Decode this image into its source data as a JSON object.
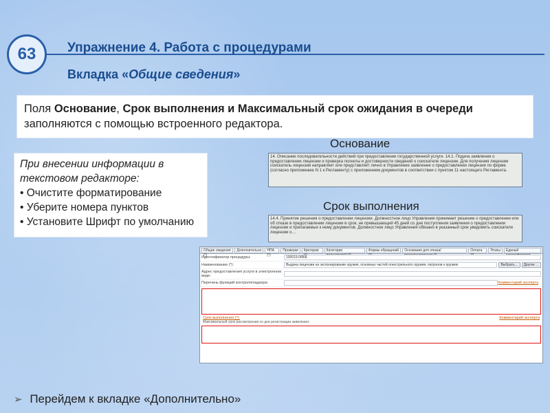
{
  "page_number": "63",
  "exercise_title": "Упражнение 4. Работа с процедурами",
  "tab_title_prefix": "Вкладка «",
  "tab_title_italic": "Общие сведения",
  "tab_title_suffix": "»",
  "fields_block": {
    "prefix": "Поля ",
    "field1": "Основание",
    "sep1": ", ",
    "field2": "Срок выполнения и Максимальный срок ожидания в очереди",
    "suffix": " заполняются с помощью встроенного редактора."
  },
  "label_osnovanie": "Основание",
  "preview_osnovanie": "14. Описание последовательности действий при предоставлении государственной услуги. 14.1. Подача заявления о предоставлении лицензии и проверка полноты и достоверности сведений о соискателе лицензии. Для получения лицензии соискатель лицензии направляет или представляет лично в Управление заявление о предоставлении лицензии по форме (согласно приложению N 1 к Регламенту) с приложением документов в соответствии с пунктом 11 настоящего Регламента.",
  "label_srok": "Срок выполнения",
  "preview_srok": "14.4. Принятие решения о предоставлении лицензии. Должностное лицо Управления принимает решение о предоставлении или об отказе в предоставлении лицензии в срок, не превышающий 45 дней со дня поступления заявления о предоставлении лицензии и прилагаемых к нему документов. Должностное лицо Управления обязано в указанный срок уведомить соискателя лицензии о…",
  "editor_note": {
    "title": "При внесении информации в текстовом редакторе:",
    "bullets": [
      "Очистите форматирование",
      "Уберите номера пунктов",
      "Установите Шрифт по умолчанию"
    ]
  },
  "form": {
    "tabs": [
      "Общие сведения (*)",
      "Дополнительно",
      "НПА (*)",
      "Проверки",
      "Критерии (*)",
      "Категории получателей (*)",
      "Формы обращений (*)",
      "Основания для отказа/приостановления (*)",
      "Оплата (*)",
      "Этапы",
      "Единый классификатор"
    ],
    "rows": {
      "id_label": "Идентификатор процедуры:",
      "id_value": "100019.0/868",
      "name_label": "Наименование (*):",
      "name_value": "Выдача лицензии на экспонирование оружия, основных частей огнестрельного оружия, патронов к оружию",
      "addr_label": "Адрес предоставления услуги в электронном виде:",
      "addr_value": "",
      "resp_label": "Перечень функций контроля/надзора:",
      "resp_value": ""
    },
    "btn_select": "Выбрать…",
    "btn_other": "Другие …",
    "comment_expert": "Комментарий эксперта",
    "srok_label": "Срок выполнения (*):",
    "max_wait_label": "Максимальный срок рассмотрения со дня регистрации заявления:"
  },
  "footer": "Перейдем к вкладке «Дополнительно»"
}
